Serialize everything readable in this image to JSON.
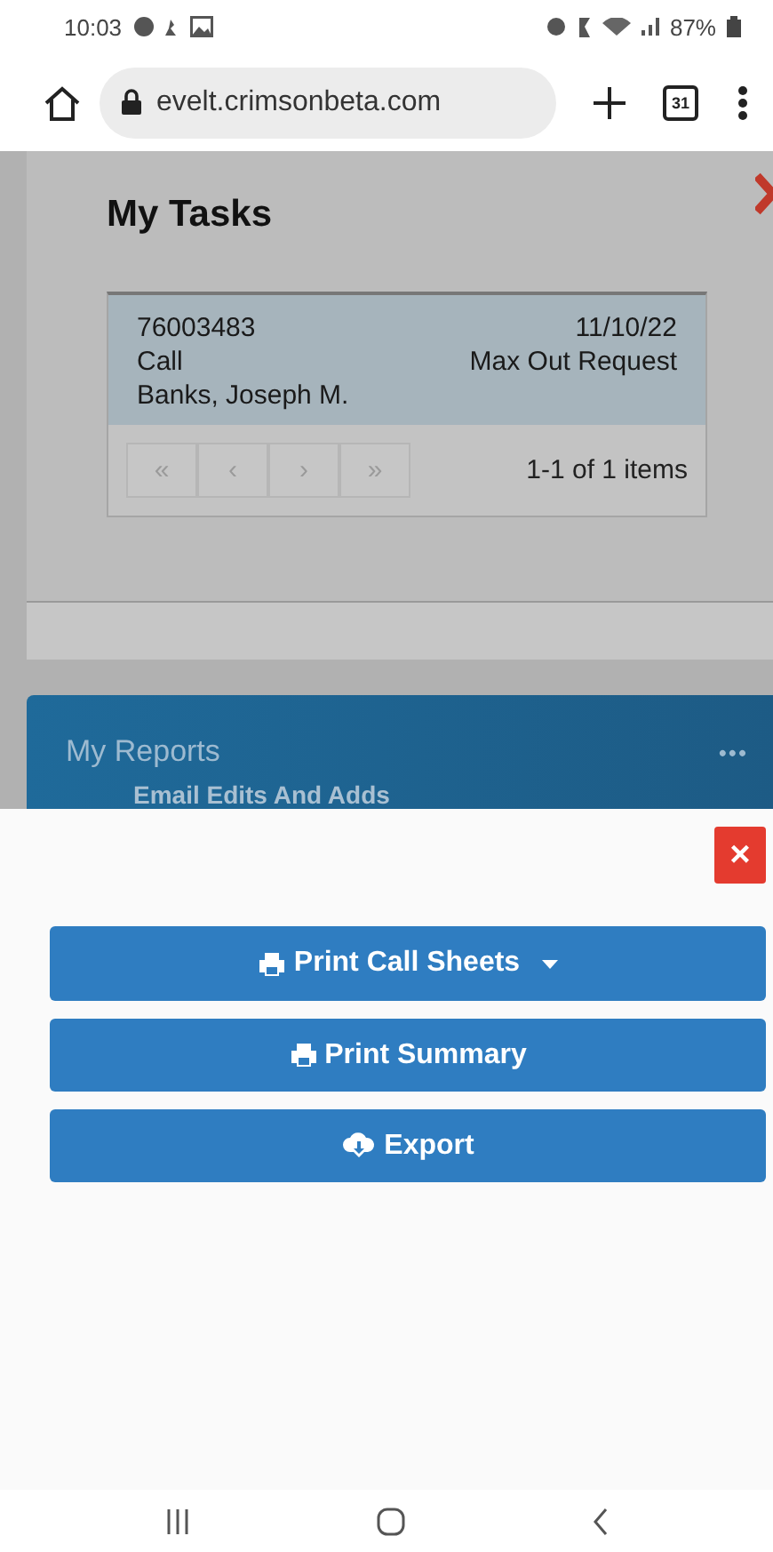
{
  "status_bar": {
    "time": "10:03",
    "battery": "87%"
  },
  "browser": {
    "url": "evelt.crimsonbeta.com",
    "tab_count": "31"
  },
  "tasks_dialog": {
    "title": "My Tasks",
    "rows": [
      {
        "id": "76003483",
        "date": "11/10/22",
        "type": "Call",
        "subject": "Max Out Request",
        "name": "Banks, Joseph M."
      }
    ],
    "pager": {
      "buttons": [
        {
          "label": "«",
          "disabled": true
        },
        {
          "label": "‹",
          "disabled": true
        },
        {
          "label": "›",
          "disabled": true
        },
        {
          "label": "»",
          "disabled": true
        }
      ],
      "summary": "1-1 of 1 items"
    }
  },
  "reports_card": {
    "title": "My Reports",
    "menu": "•••",
    "items": [
      "Email Edits And Adds"
    ]
  },
  "sheet": {
    "close": "×",
    "actions": [
      {
        "label": "Print Call Sheets",
        "kind": "print",
        "dropdown": true
      },
      {
        "label": "Print Summary",
        "kind": "print",
        "dropdown": false
      },
      {
        "label": "Export",
        "kind": "export",
        "dropdown": false
      }
    ]
  }
}
